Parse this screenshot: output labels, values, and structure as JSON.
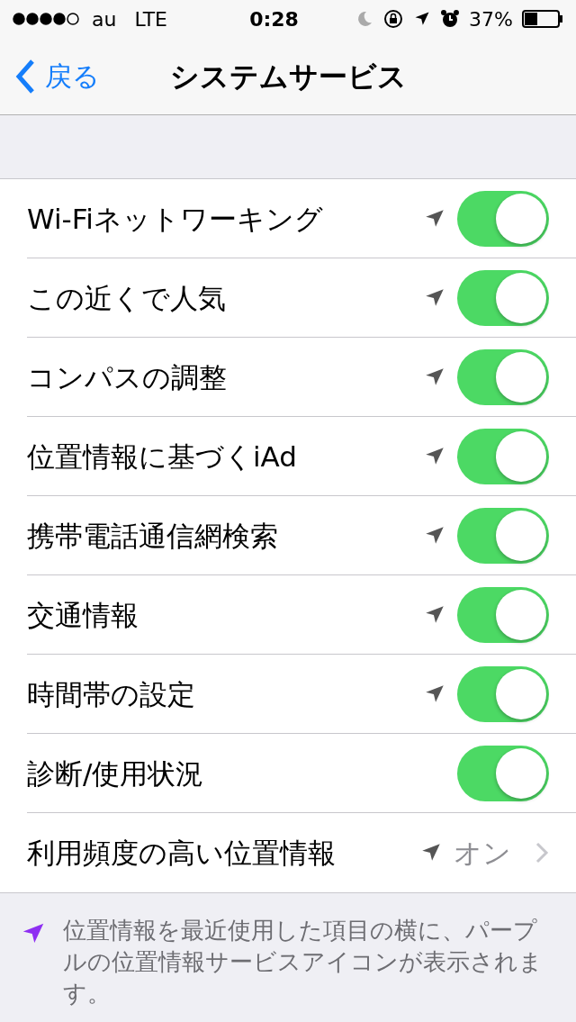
{
  "status_bar": {
    "carrier": "au",
    "network": "LTE",
    "time": "0:28",
    "battery": "37%"
  },
  "nav": {
    "back": "戻る",
    "title": "システムサービス"
  },
  "rows": [
    {
      "kind": "toggle",
      "label": "Wi-Fiネットワーキング",
      "location_icon": true,
      "on": true
    },
    {
      "kind": "toggle",
      "label": "この近くで人気",
      "location_icon": true,
      "on": true
    },
    {
      "kind": "toggle",
      "label": "コンパスの調整",
      "location_icon": true,
      "on": true
    },
    {
      "kind": "toggle",
      "label": "位置情報に基づくiAd",
      "location_icon": true,
      "on": true
    },
    {
      "kind": "toggle",
      "label": "携帯電話通信網検索",
      "location_icon": true,
      "on": true
    },
    {
      "kind": "toggle",
      "label": "交通情報",
      "location_icon": true,
      "on": true
    },
    {
      "kind": "toggle",
      "label": "時間帯の設定",
      "location_icon": true,
      "on": true
    },
    {
      "kind": "toggle",
      "label": "診断/使用状況",
      "location_icon": false,
      "on": true
    },
    {
      "kind": "link",
      "label": "利用頻度の高い位置情報",
      "location_icon": true,
      "value": "オン"
    }
  ],
  "footer": {
    "note": "位置情報を最近使用した項目の横に、パープルの位置情報サービスアイコンが表示されます。"
  }
}
